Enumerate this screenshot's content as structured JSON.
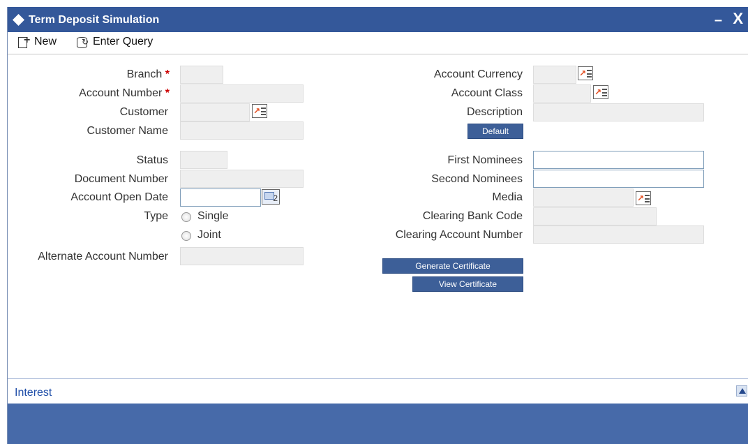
{
  "window": {
    "title": "Term Deposit Simulation",
    "minimize": "–",
    "close": "X"
  },
  "toolbar": {
    "new_label": "New",
    "enter_query_label": "Enter Query"
  },
  "left_form": {
    "branch": {
      "label": "Branch",
      "required": "*"
    },
    "account_number": {
      "label": "Account Number",
      "required": "*"
    },
    "customer": {
      "label": "Customer"
    },
    "customer_name": {
      "label": "Customer Name"
    },
    "status": {
      "label": "Status"
    },
    "document_number": {
      "label": "Document Number"
    },
    "account_open_date": {
      "label": "Account Open Date",
      "calendar_icon_text": "2"
    },
    "type": {
      "label": "Type",
      "options": [
        "Single",
        "Joint"
      ]
    },
    "alternate_account_number": {
      "label": "Alternate Account Number"
    }
  },
  "right_form": {
    "account_currency": {
      "label": "Account Currency"
    },
    "account_class": {
      "label": "Account Class"
    },
    "description": {
      "label": "Description"
    },
    "default_button": "Default",
    "first_nominees": {
      "label": "First Nominees"
    },
    "second_nominees": {
      "label": "Second Nominees"
    },
    "media": {
      "label": "Media"
    },
    "clearing_bank_code": {
      "label": "Clearing Bank Code"
    },
    "clearing_account_number": {
      "label": "Clearing Account Number"
    },
    "generate_certificate_button": "Generate Certificate",
    "view_certificate_button": "View Certificate"
  },
  "bottom_tabs": {
    "interest": "Interest"
  },
  "colors": {
    "titlebar": "#34589a",
    "button": "#3d5f98",
    "footer": "#476aa9",
    "required": "#cc0000",
    "link": "#1f4ea8"
  },
  "icons": {
    "new": "new-document-icon",
    "enter_query": "query-icon",
    "lov": "list-of-values-icon",
    "calendar": "calendar-icon"
  }
}
